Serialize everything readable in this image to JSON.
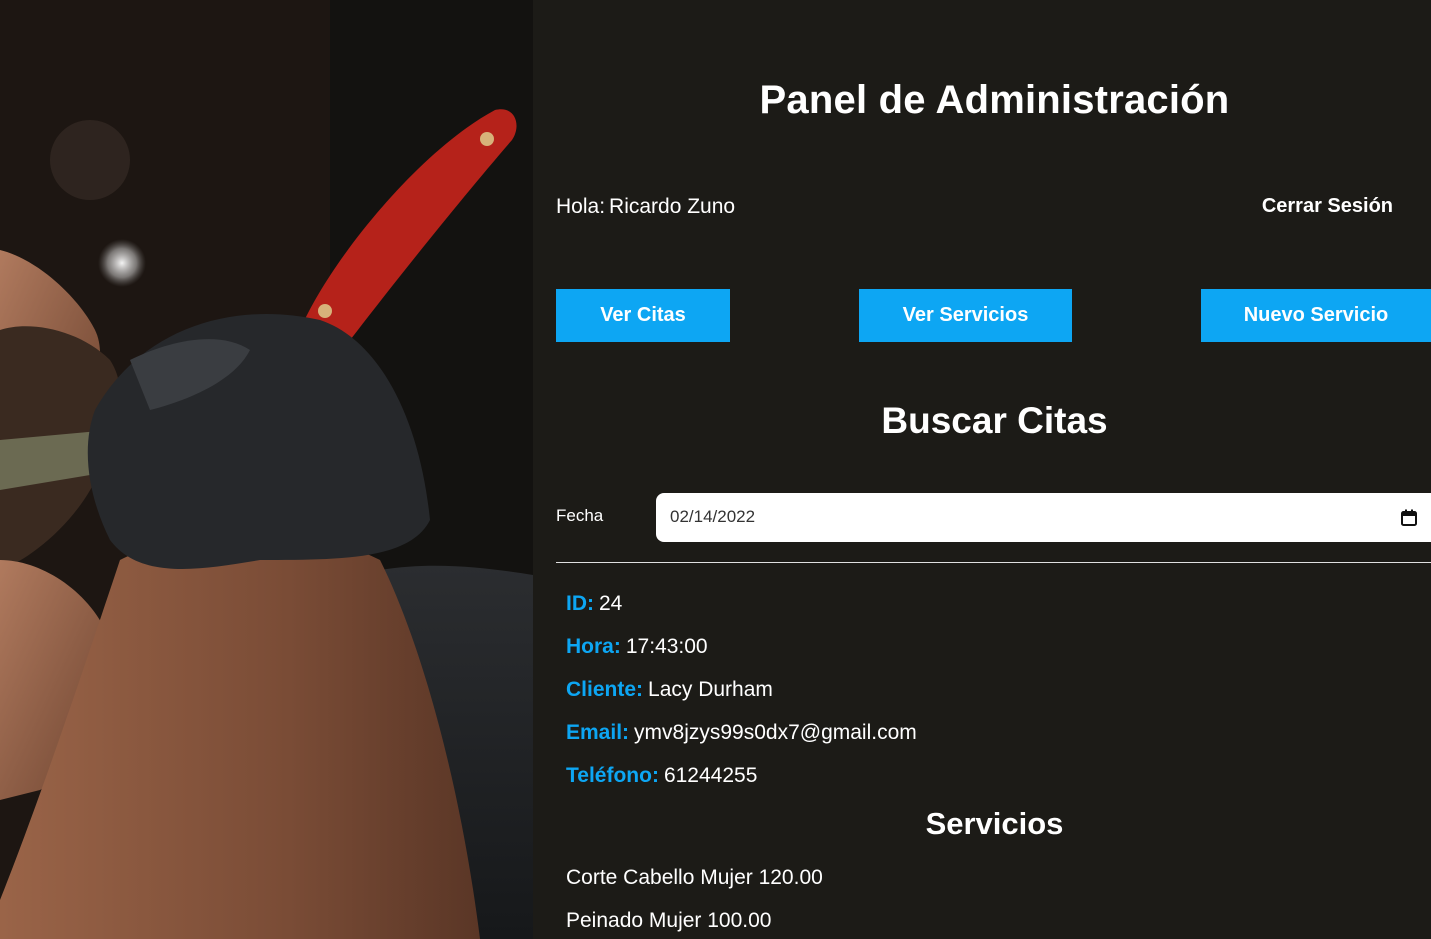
{
  "photo": {
    "alt": "barber-shaving-photo"
  },
  "header": {
    "title": "Panel de Administración",
    "greeting_label": "Hola:",
    "user_name": "Ricardo Zuno",
    "logout_label": "Cerrar Sesión"
  },
  "nav": {
    "buttons": [
      {
        "label": "Ver Citas"
      },
      {
        "label": "Ver Servicios"
      },
      {
        "label": "Nuevo Servicio"
      }
    ]
  },
  "search": {
    "title": "Buscar Citas",
    "date_label": "Fecha",
    "date_value": "02/14/2022",
    "calendar_icon": "calendar-icon"
  },
  "appointment": {
    "id_label": "ID:",
    "id_value": "24",
    "hora_label": "Hora:",
    "hora_value": "17:43:00",
    "cliente_label": "Cliente:",
    "cliente_value": "Lacy Durham",
    "email_label": "Email:",
    "email_value": "ymv8jzys99s0dx7@gmail.com",
    "telefono_label": "Teléfono:",
    "telefono_value": "61244255"
  },
  "services": {
    "title": "Servicios",
    "items": [
      {
        "text": "Corte Cabello Mujer 120.00"
      },
      {
        "text": "Peinado Mujer 100.00"
      }
    ]
  },
  "colors": {
    "accent": "#0da6f3",
    "background": "#1c1b17",
    "text": "#ffffff"
  }
}
